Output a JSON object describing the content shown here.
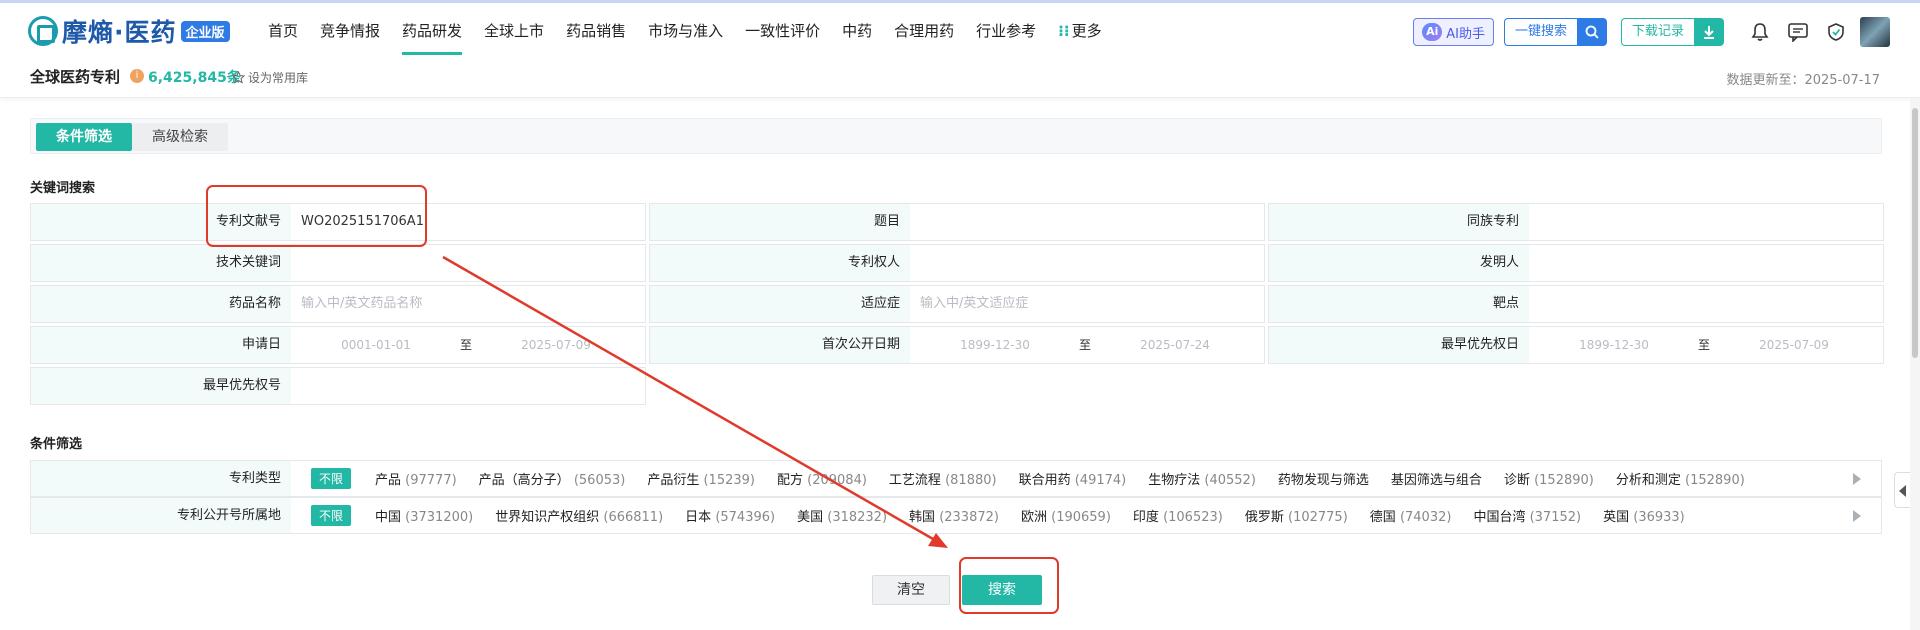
{
  "header": {
    "logo_text": "摩熵·医药",
    "logo_badge": "企业版",
    "nav": [
      "首页",
      "竞争情报",
      "药品研发",
      "全球上市",
      "药品销售",
      "市场与准入",
      "一致性评价",
      "中药",
      "合理用药",
      "行业参考"
    ],
    "nav_active_index": 2,
    "nav_more": "更多",
    "ai_button": "AI助手",
    "ai_icon_text": "Ai",
    "quick_search": "一键搜索",
    "download": "下载记录"
  },
  "subbar": {
    "title": "全球医药专利",
    "count": "6,425,845条",
    "favorite": "设为常用库",
    "update_label": "数据更新至：2025-07-17"
  },
  "tabs": {
    "active": "条件筛选",
    "inactive": "高级检索"
  },
  "keyword_section": {
    "title": "关键词搜索",
    "rows": [
      [
        {
          "label": "专利文献号",
          "value": "WO2025151706A1",
          "placeholder": ""
        },
        {
          "label": "题目",
          "value": "",
          "placeholder": ""
        },
        {
          "label": "同族专利",
          "value": "",
          "placeholder": ""
        }
      ],
      [
        {
          "label": "技术关键词",
          "value": "",
          "placeholder": ""
        },
        {
          "label": "专利权人",
          "value": "",
          "placeholder": ""
        },
        {
          "label": "发明人",
          "value": "",
          "placeholder": ""
        }
      ],
      [
        {
          "label": "药品名称",
          "value": "",
          "placeholder": "输入中/英文药品名称"
        },
        {
          "label": "适应症",
          "value": "",
          "placeholder": "输入中/英文适应症"
        },
        {
          "label": "靶点",
          "value": "",
          "placeholder": ""
        }
      ]
    ],
    "date_row": [
      {
        "label": "申请日",
        "from": "0001-01-01",
        "to": "2025-07-09",
        "sep": "至"
      },
      {
        "label": "首次公开日期",
        "from": "1899-12-30",
        "to": "2025-07-24",
        "sep": "至"
      },
      {
        "label": "最早优先权日",
        "from": "1899-12-30",
        "to": "2025-07-09",
        "sep": "至"
      }
    ],
    "last_row": {
      "label": "最早优先权号",
      "value": ""
    }
  },
  "filter_section": {
    "title": "条件筛选",
    "unlimited": "不限",
    "rows": [
      {
        "label": "专利类型",
        "options": [
          {
            "name": "产品",
            "count": "(97777)"
          },
          {
            "name": "产品（高分子）",
            "count": "(56053)"
          },
          {
            "name": "产品衍生",
            "count": "(15239)"
          },
          {
            "name": "配方",
            "count": "(209084)"
          },
          {
            "name": "工艺流程",
            "count": "(81880)"
          },
          {
            "name": "联合用药",
            "count": "(49174)"
          },
          {
            "name": "生物疗法",
            "count": "(40552)"
          },
          {
            "name": "药物发现与筛选",
            "count": ""
          },
          {
            "name": "基因筛选与组合",
            "count": ""
          },
          {
            "name": "诊断",
            "count": "(152890)"
          },
          {
            "name": "分析和测定",
            "count": "(152890)"
          }
        ]
      },
      {
        "label": "专利公开号所属地",
        "options": [
          {
            "name": "中国",
            "count": "(3731200)"
          },
          {
            "name": "世界知识产权组织",
            "count": "(666811)"
          },
          {
            "name": "日本",
            "count": "(574396)"
          },
          {
            "name": "美国",
            "count": "(318232)"
          },
          {
            "name": "韩国",
            "count": "(233872)"
          },
          {
            "name": "欧洲",
            "count": "(190659)"
          },
          {
            "name": "印度",
            "count": "(106523)"
          },
          {
            "name": "俄罗斯",
            "count": "(102775)"
          },
          {
            "name": "德国",
            "count": "(74032)"
          },
          {
            "name": "中国台湾",
            "count": "(37152)"
          },
          {
            "name": "英国",
            "count": "(36933)"
          }
        ]
      }
    ]
  },
  "actions": {
    "clear": "清空",
    "search": "搜索"
  },
  "colors": {
    "accent": "#23b7a5",
    "brand_blue": "#2f7be6",
    "annotation_red": "#e03a2a"
  }
}
